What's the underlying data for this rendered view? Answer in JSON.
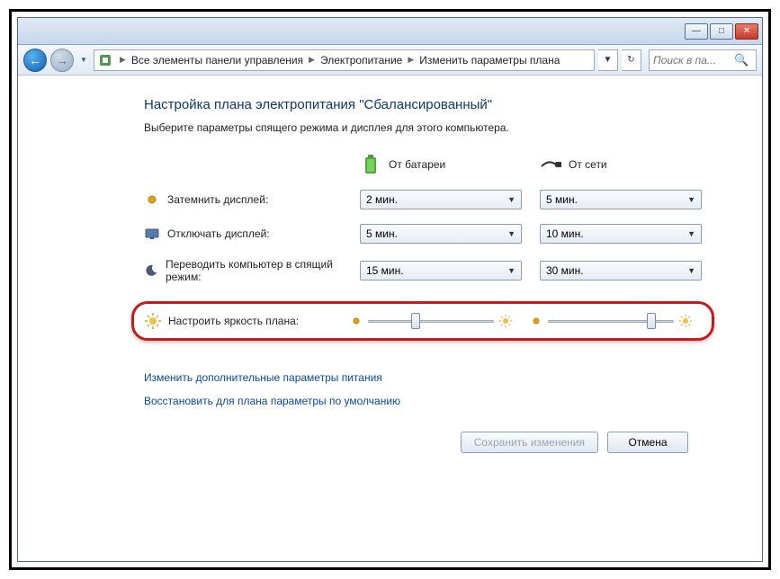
{
  "window": {
    "min_label": "—",
    "max_label": "□",
    "close_label": "✕"
  },
  "nav": {
    "back": "←",
    "forward": "→",
    "dropdown_arrow": "▼",
    "breadcrumb_dropdown": "▼",
    "refresh": "↻"
  },
  "breadcrumb": {
    "items": [
      "Все элементы панели управления",
      "Электропитание",
      "Изменить параметры плана"
    ]
  },
  "search": {
    "placeholder": "Поиск в па..."
  },
  "page": {
    "title": "Настройка плана электропитания \"Сбалансированный\"",
    "subtitle": "Выберите параметры спящего режима и дисплея для этого компьютера."
  },
  "columns": {
    "battery": "От батареи",
    "plugged": "От сети"
  },
  "rows": {
    "dim": "Затемнить дисплей:",
    "off": "Отключать дисплей:",
    "sleep": "Переводить компьютер в спящий режим:",
    "brightness": "Настроить яркость плана:"
  },
  "values": {
    "dim_battery": "2 мин.",
    "dim_plugged": "5 мин.",
    "off_battery": "5 мин.",
    "off_plugged": "10 мин.",
    "sleep_battery": "15 мин.",
    "sleep_plugged": "30 мин.",
    "brightness_battery_pct": 38,
    "brightness_plugged_pct": 82
  },
  "links": {
    "advanced": "Изменить дополнительные параметры питания",
    "restore": "Восстановить для плана параметры по умолчанию"
  },
  "buttons": {
    "save": "Сохранить изменения",
    "cancel": "Отмена"
  }
}
